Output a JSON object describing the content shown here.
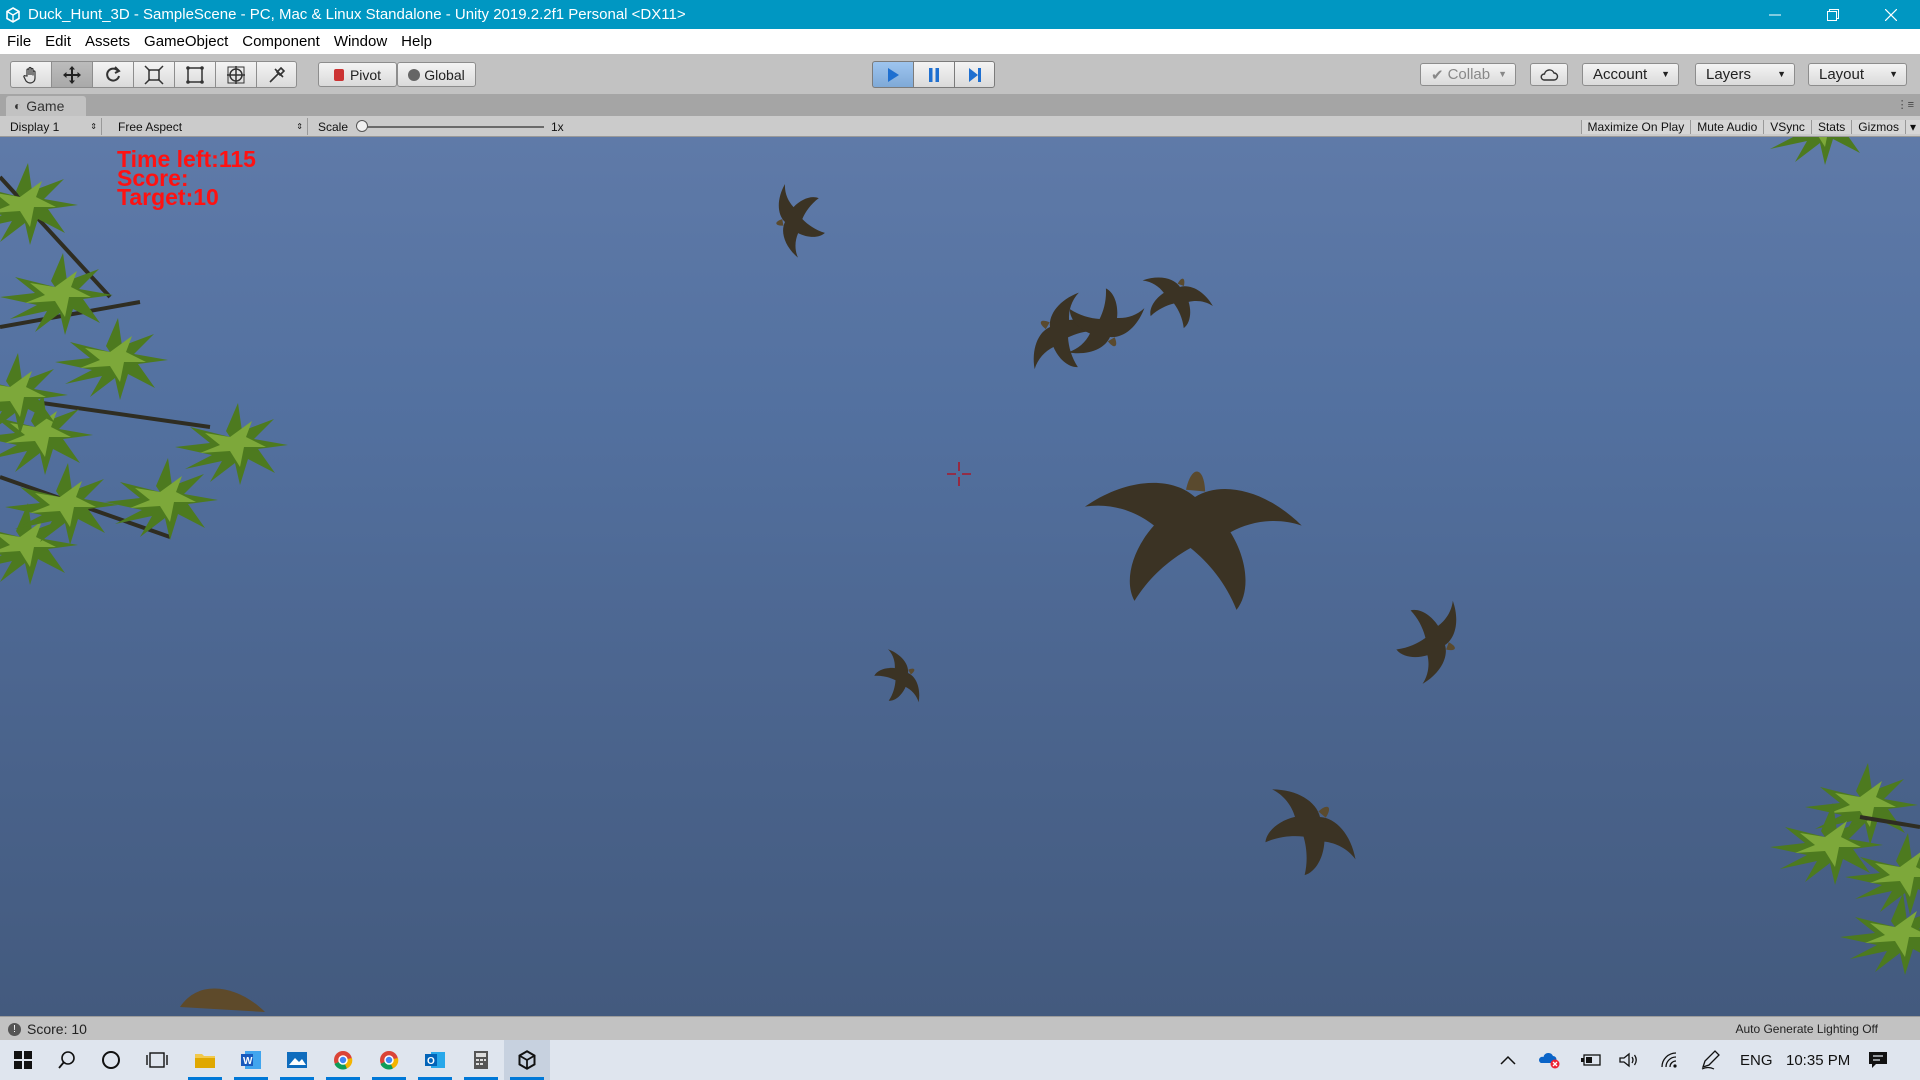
{
  "window": {
    "title": "Duck_Hunt_3D - SampleScene - PC, Mac & Linux Standalone - Unity 2019.2.2f1 Personal <DX11>",
    "controls": [
      "minimize-icon",
      "restore-icon",
      "close-icon"
    ]
  },
  "menu": [
    "File",
    "Edit",
    "Assets",
    "GameObject",
    "Component",
    "Window",
    "Help"
  ],
  "toolbar": {
    "tools": [
      "hand-icon",
      "move-icon",
      "rotate-icon",
      "scale-icon",
      "rect-icon",
      "transform-icon",
      "custom-tool-icon"
    ],
    "active_tool": "move-icon",
    "pivot": "Pivot",
    "global": "Global",
    "collab": "Collab",
    "account": "Account",
    "layers": "Layers",
    "layout": "Layout"
  },
  "tab": {
    "label": "Game"
  },
  "gamebar": {
    "display": "Display 1",
    "aspect": "Free Aspect",
    "scale_label": "Scale",
    "scale_value": "1x",
    "maximize": "Maximize On Play",
    "mute": "Mute Audio",
    "vsync": "VSync",
    "stats": "Stats",
    "gizmos": "Gizmos"
  },
  "hud": {
    "time_left": "Time left:115",
    "score": "Score:",
    "target": "Target:10"
  },
  "status": {
    "message": "Score: 10",
    "lighting": "Auto Generate Lighting Off"
  },
  "taskbar": {
    "language": "ENG",
    "time": "10:35 PM"
  },
  "colors": {
    "titlebar": "#0097c2",
    "hud_text": "#ff1111",
    "sky_top": "#5f7aa8",
    "sky_bottom": "#435a7e"
  }
}
